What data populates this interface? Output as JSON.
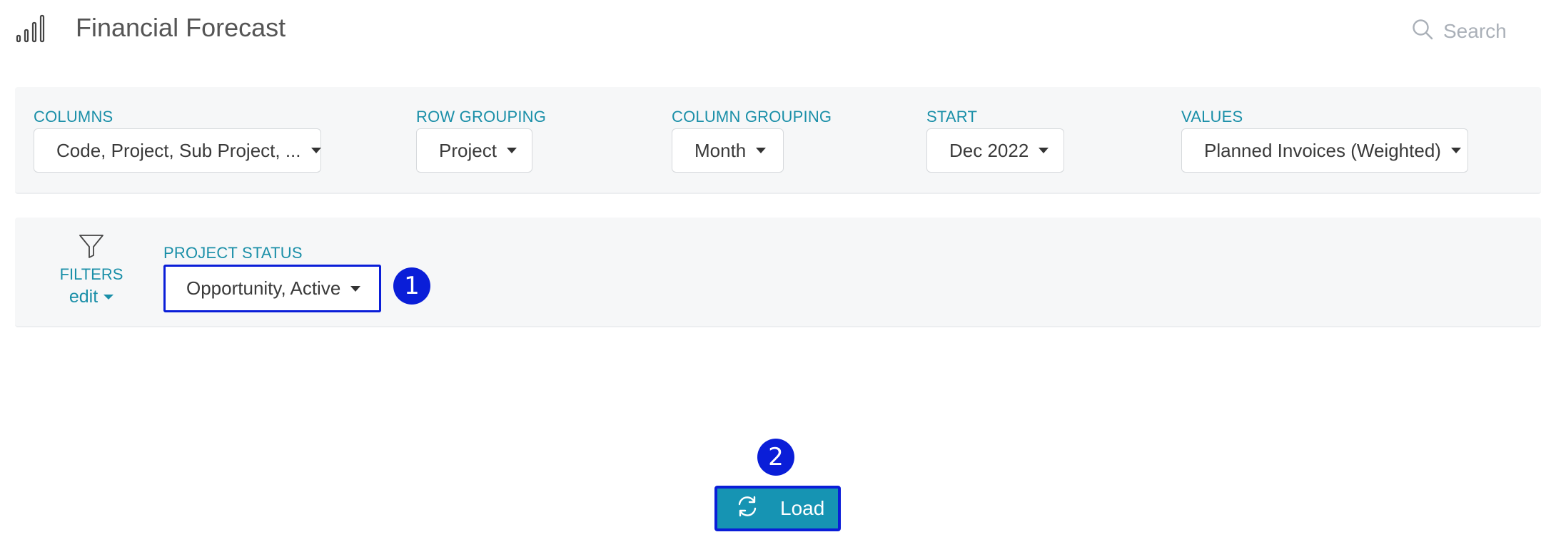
{
  "header": {
    "title": "Financial Forecast",
    "search_placeholder": "Search"
  },
  "options": {
    "columns": {
      "label": "COLUMNS",
      "value": "Code, Project, Sub Project, ..."
    },
    "row_grouping": {
      "label": "ROW GROUPING",
      "value": "Project"
    },
    "column_grouping": {
      "label": "COLUMN GROUPING",
      "value": "Month"
    },
    "start": {
      "label": "START",
      "value": "Dec 2022"
    },
    "values": {
      "label": "VALUES",
      "value": "Planned Invoices (Weighted)"
    }
  },
  "filters": {
    "label": "FILTERS",
    "edit_label": "edit",
    "project_status": {
      "label": "PROJECT STATUS",
      "value": "Opportunity, Active"
    }
  },
  "annotations": {
    "step1": "1",
    "step2": "2"
  },
  "actions": {
    "load_label": "Load"
  },
  "colors": {
    "accent": "#1694b3",
    "label_teal": "#1a8fa8",
    "highlight": "#0a1ed8"
  },
  "icons": [
    "signal-bars-icon",
    "search-icon",
    "filter-funnel-icon",
    "refresh-icon"
  ]
}
